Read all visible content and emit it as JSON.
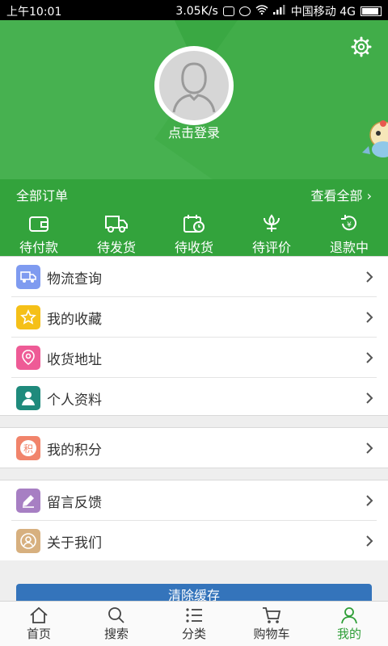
{
  "status_bar": {
    "time": "上午10:01",
    "net_speed": "3.05K/s",
    "carrier": "中国移动 4G"
  },
  "profile": {
    "login_label": "点击登录"
  },
  "orders": {
    "title": "全部订单",
    "view_all": "查看全部",
    "statuses": [
      {
        "label": "待付款",
        "icon": "wallet-icon"
      },
      {
        "label": "待发货",
        "icon": "truck-icon"
      },
      {
        "label": "待收货",
        "icon": "calendar-clock-icon"
      },
      {
        "label": "待评价",
        "icon": "flower-icon"
      },
      {
        "label": "退款中",
        "icon": "refund-icon"
      }
    ]
  },
  "menu_group1": [
    {
      "label": "物流查询",
      "icon": "truck-icon",
      "color": "#7f9bf0"
    },
    {
      "label": "我的收藏",
      "icon": "star-icon",
      "color": "#f5c018"
    },
    {
      "label": "收货地址",
      "icon": "location-pin-icon",
      "color": "#ee5b96"
    },
    {
      "label": "个人资料",
      "icon": "person-icon",
      "color": "#1f8a7c"
    }
  ],
  "menu_group2": [
    {
      "label": "我的积分",
      "icon": "points-icon",
      "icon_text": "积",
      "color": "#f1846b"
    }
  ],
  "menu_group3": [
    {
      "label": "留言反馈",
      "icon": "pencil-icon",
      "color": "#a77fc3"
    },
    {
      "label": "关于我们",
      "icon": "user-circle-icon",
      "color": "#d7b07f"
    }
  ],
  "clear_cache": "清除缓存",
  "tabs": [
    {
      "label": "首页",
      "icon": "home-icon",
      "active": false
    },
    {
      "label": "搜索",
      "icon": "search-icon",
      "active": false
    },
    {
      "label": "分类",
      "icon": "list-icon",
      "active": false
    },
    {
      "label": "购物车",
      "icon": "cart-icon",
      "active": false
    },
    {
      "label": "我的",
      "icon": "user-icon",
      "active": true
    }
  ],
  "colors": {
    "header_green": "#3aa843",
    "active_tab": "#2e9e37",
    "button_blue": "#3474bb"
  }
}
